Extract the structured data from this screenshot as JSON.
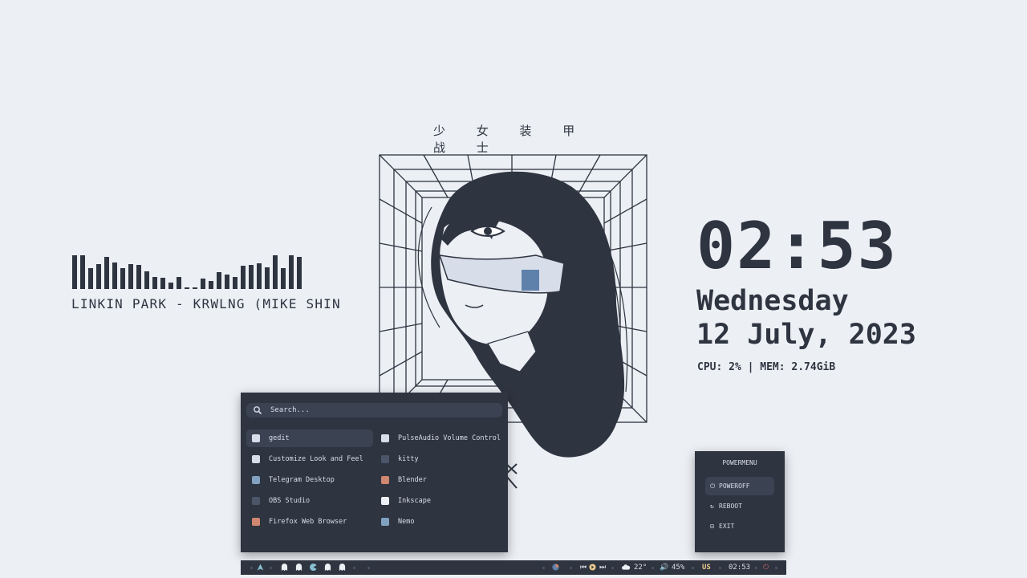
{
  "art_title": "少 女 装 甲 战 士",
  "visualizer": {
    "levels": [
      0.95,
      0.95,
      0.6,
      0.7,
      0.92,
      0.75,
      0.6,
      0.7,
      0.68,
      0.5,
      0.35,
      0.32,
      0.18,
      0.33,
      0.05,
      0.05,
      0.3,
      0.22,
      0.48,
      0.42,
      0.35,
      0.65,
      0.68,
      0.72,
      0.62,
      0.95,
      0.6,
      0.95,
      0.9
    ],
    "song": "LINKIN PARK - KRWLNG (MIKE SHIN"
  },
  "clock": {
    "time": "02:53",
    "weekday": "Wednesday",
    "date": "12 July, 2023",
    "sysinfo": "CPU: 2% | MEM: 2.74GiB"
  },
  "launcher": {
    "search_placeholder": "Search...",
    "apps_left": [
      {
        "name": "gedit",
        "icon": "gedit-icon",
        "color": "#d8dee9"
      },
      {
        "name": "Customize Look and Feel",
        "icon": "palette-icon",
        "color": "#d8dee9"
      },
      {
        "name": "Telegram Desktop",
        "icon": "telegram-icon",
        "color": "#81a1c1"
      },
      {
        "name": "OBS Studio",
        "icon": "obs-icon",
        "color": "#4c566a"
      },
      {
        "name": "Firefox Web Browser",
        "icon": "firefox-icon",
        "color": "#d08770"
      }
    ],
    "apps_right": [
      {
        "name": "PulseAudio Volume Control",
        "icon": "speaker-icon",
        "color": "#d8dee9"
      },
      {
        "name": "kitty",
        "icon": "kitty-icon",
        "color": "#4c566a"
      },
      {
        "name": "Blender",
        "icon": "blender-icon",
        "color": "#d08770"
      },
      {
        "name": "Inkscape",
        "icon": "inkscape-icon",
        "color": "#eceff4"
      },
      {
        "name": "Nemo",
        "icon": "folder-icon",
        "color": "#81a1c1"
      }
    ]
  },
  "powermenu": {
    "title": "POWERMENU",
    "poweroff": "POWEROFF",
    "reboot": "REBOOT",
    "exit": "EXIT"
  },
  "taskbar": {
    "weather_temp": "22°",
    "volume": "45%",
    "keyboard_layout": "US",
    "time": "02:53"
  },
  "colors": {
    "background": "#eceff4",
    "panel": "#2e3440",
    "panel_selected": "#3b4252",
    "text_light": "#d8dee9",
    "accent_yellow": "#ebcb8b",
    "accent_red": "#bf616a",
    "accent_blue": "#88c0d0"
  }
}
